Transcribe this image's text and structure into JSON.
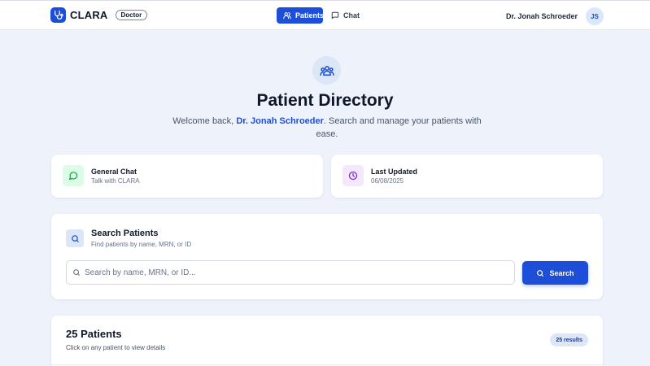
{
  "header": {
    "brand": "CLARA",
    "role_badge": "Doctor",
    "nav": [
      {
        "label": "Patients",
        "icon": "users-icon",
        "active": true
      },
      {
        "label": "Chat",
        "icon": "chat-bubble-icon",
        "active": false
      }
    ],
    "user_name": "Dr. Jonah Schroeder",
    "avatar_initials": "JS"
  },
  "hero": {
    "icon": "users-group-icon",
    "title": "Patient Directory",
    "welcome_prefix": "Welcome back, ",
    "welcome_name": "Dr. Jonah Schroeder",
    "welcome_suffix": ". Search and manage your patients with ease."
  },
  "info_cards": [
    {
      "title": "General Chat",
      "subtitle": "Talk with CLARA",
      "icon": "message-icon",
      "accent": "#16a34a"
    },
    {
      "title": "Last Updated",
      "subtitle": "06/08/2025",
      "icon": "clock-icon",
      "accent": "#7e22ce"
    }
  ],
  "search": {
    "title": "Search Patients",
    "subtitle": "Find patients by name, MRN, or ID",
    "placeholder": "Search by name, MRN, or ID...",
    "value": "",
    "button_label": "Search"
  },
  "patients": {
    "count_label": "25 Patients",
    "hint": "Click on any patient to view details",
    "results_badge": "25 results"
  },
  "colors": {
    "primary": "#1d4ed8",
    "background": "#eef3fb",
    "chat_accent": "#16a34a",
    "updated_accent": "#7e22ce"
  }
}
